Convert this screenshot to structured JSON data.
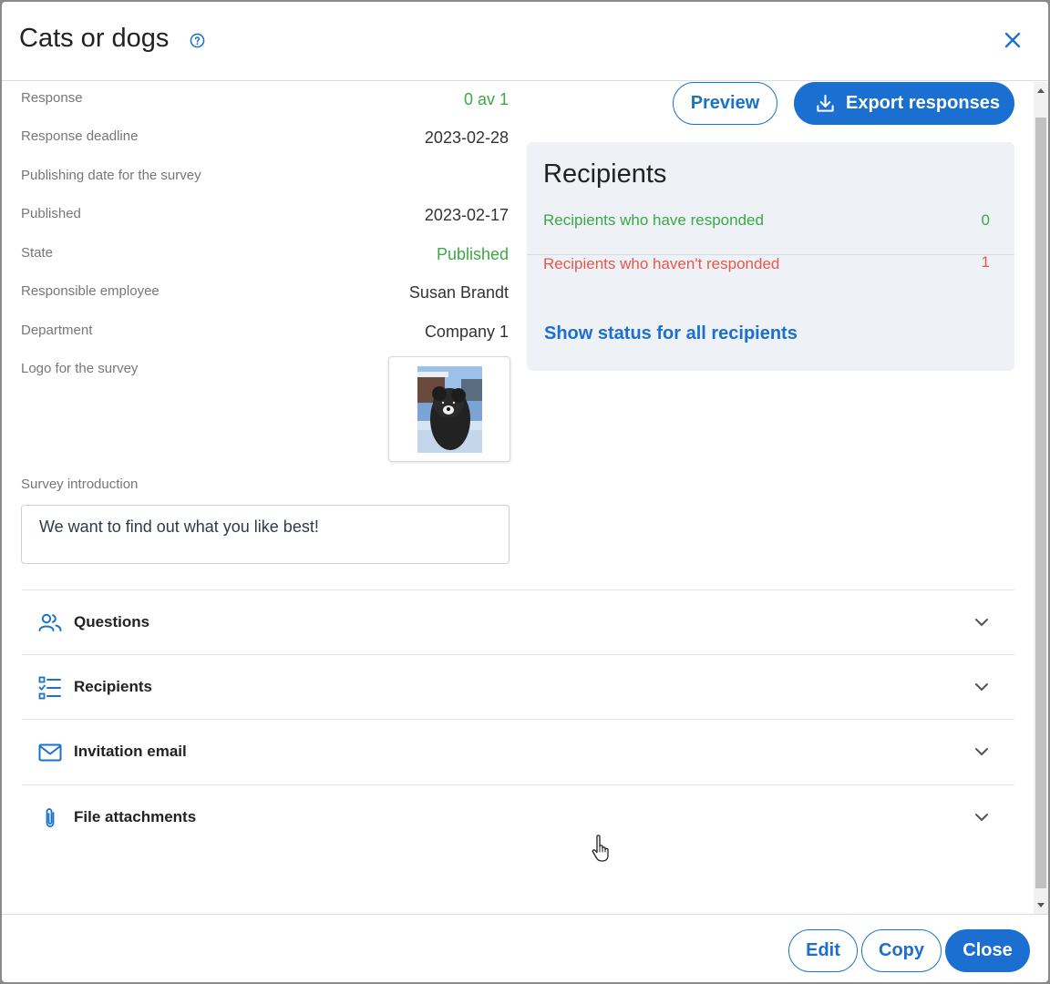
{
  "dialog": {
    "title": "Cats or dogs",
    "close_label": "×"
  },
  "details": [
    {
      "label": "Response",
      "value": "0 av 1",
      "color": "#3aa844"
    },
    {
      "label": "Response deadline",
      "value": "2023-02-28"
    },
    {
      "label": "Publishing date for the survey",
      "value": ""
    },
    {
      "label": "Published",
      "value": "2023-02-17"
    },
    {
      "label": "State",
      "value": "Published",
      "color": "#3aa844"
    },
    {
      "label": "Responsible employee",
      "value": "Susan Brandt"
    },
    {
      "label": "Department",
      "value": "Company 1"
    }
  ],
  "logo": {
    "label": "Logo for the survey"
  },
  "intro": {
    "label": "Survey introduction",
    "text": "We want to find out what you like best!"
  },
  "actions": {
    "preview": "Preview",
    "export": "Export responses"
  },
  "recipients_card": {
    "title": "Recipients",
    "responded_label": "Recipients who have responded",
    "responded_count": "0",
    "not_responded_label": "Recipients who haven't responded",
    "not_responded_count": "1",
    "show_status": "Show status for all recipients"
  },
  "accordion": [
    {
      "label": "Questions",
      "icon": "people-icon"
    },
    {
      "label": "Recipients",
      "icon": "checklist-icon"
    },
    {
      "label": "Invitation email",
      "icon": "envelope-icon"
    },
    {
      "label": "File attachments",
      "icon": "paperclip-icon"
    }
  ],
  "footer": {
    "edit": "Edit",
    "copy": "Copy",
    "close": "Close"
  },
  "colors": {
    "primary": "#1a6fd0",
    "success": "#3aa844",
    "danger": "#e8574a",
    "card_bg": "#eef2f6"
  }
}
